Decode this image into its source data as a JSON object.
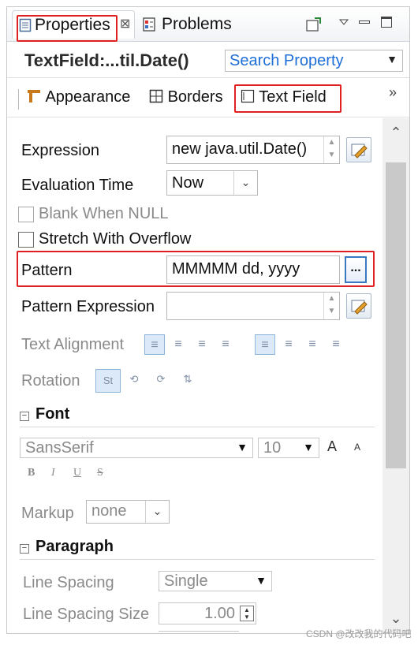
{
  "tabs": {
    "properties": "Properties",
    "close_glyph": "⊠",
    "problems": "Problems"
  },
  "title": {
    "text": "TextField:...til.Date()",
    "search_placeholder": "Search Property"
  },
  "section_tabs": {
    "appearance": "Appearance",
    "borders": "Borders",
    "text_field": "Text Field",
    "more": "»"
  },
  "form": {
    "expression_label": "Expression",
    "expression_value": "new java.util.Date()",
    "evaluation_time_label": "Evaluation Time",
    "evaluation_time_value": "Now",
    "blank_when_null": "Blank When NULL",
    "stretch_with_overflow": "Stretch With Overflow",
    "pattern_label": "Pattern",
    "pattern_value": "MMMMM dd, yyyy",
    "pattern_button": "...",
    "pattern_expression_label": "Pattern Expression",
    "pattern_expression_value": "",
    "text_alignment_label": "Text Alignment",
    "rotation_label": "Rotation"
  },
  "font": {
    "header": "Font",
    "family": "SansSerif",
    "size": "10",
    "increase": "A",
    "decrease": "A",
    "bold": "B",
    "italic": "I",
    "underline": "U",
    "strike": "S",
    "markup_label": "Markup",
    "markup_value": "none"
  },
  "paragraph": {
    "header": "Paragraph",
    "line_spacing_label": "Line Spacing",
    "line_spacing_value": "Single",
    "line_spacing_size_label": "Line Spacing Size",
    "line_spacing_size_value": "1.00"
  },
  "watermark": "CSDN @改改我的代码吧",
  "colors": {
    "highlight": "#e02020",
    "link_blue": "#1e6fd8"
  }
}
